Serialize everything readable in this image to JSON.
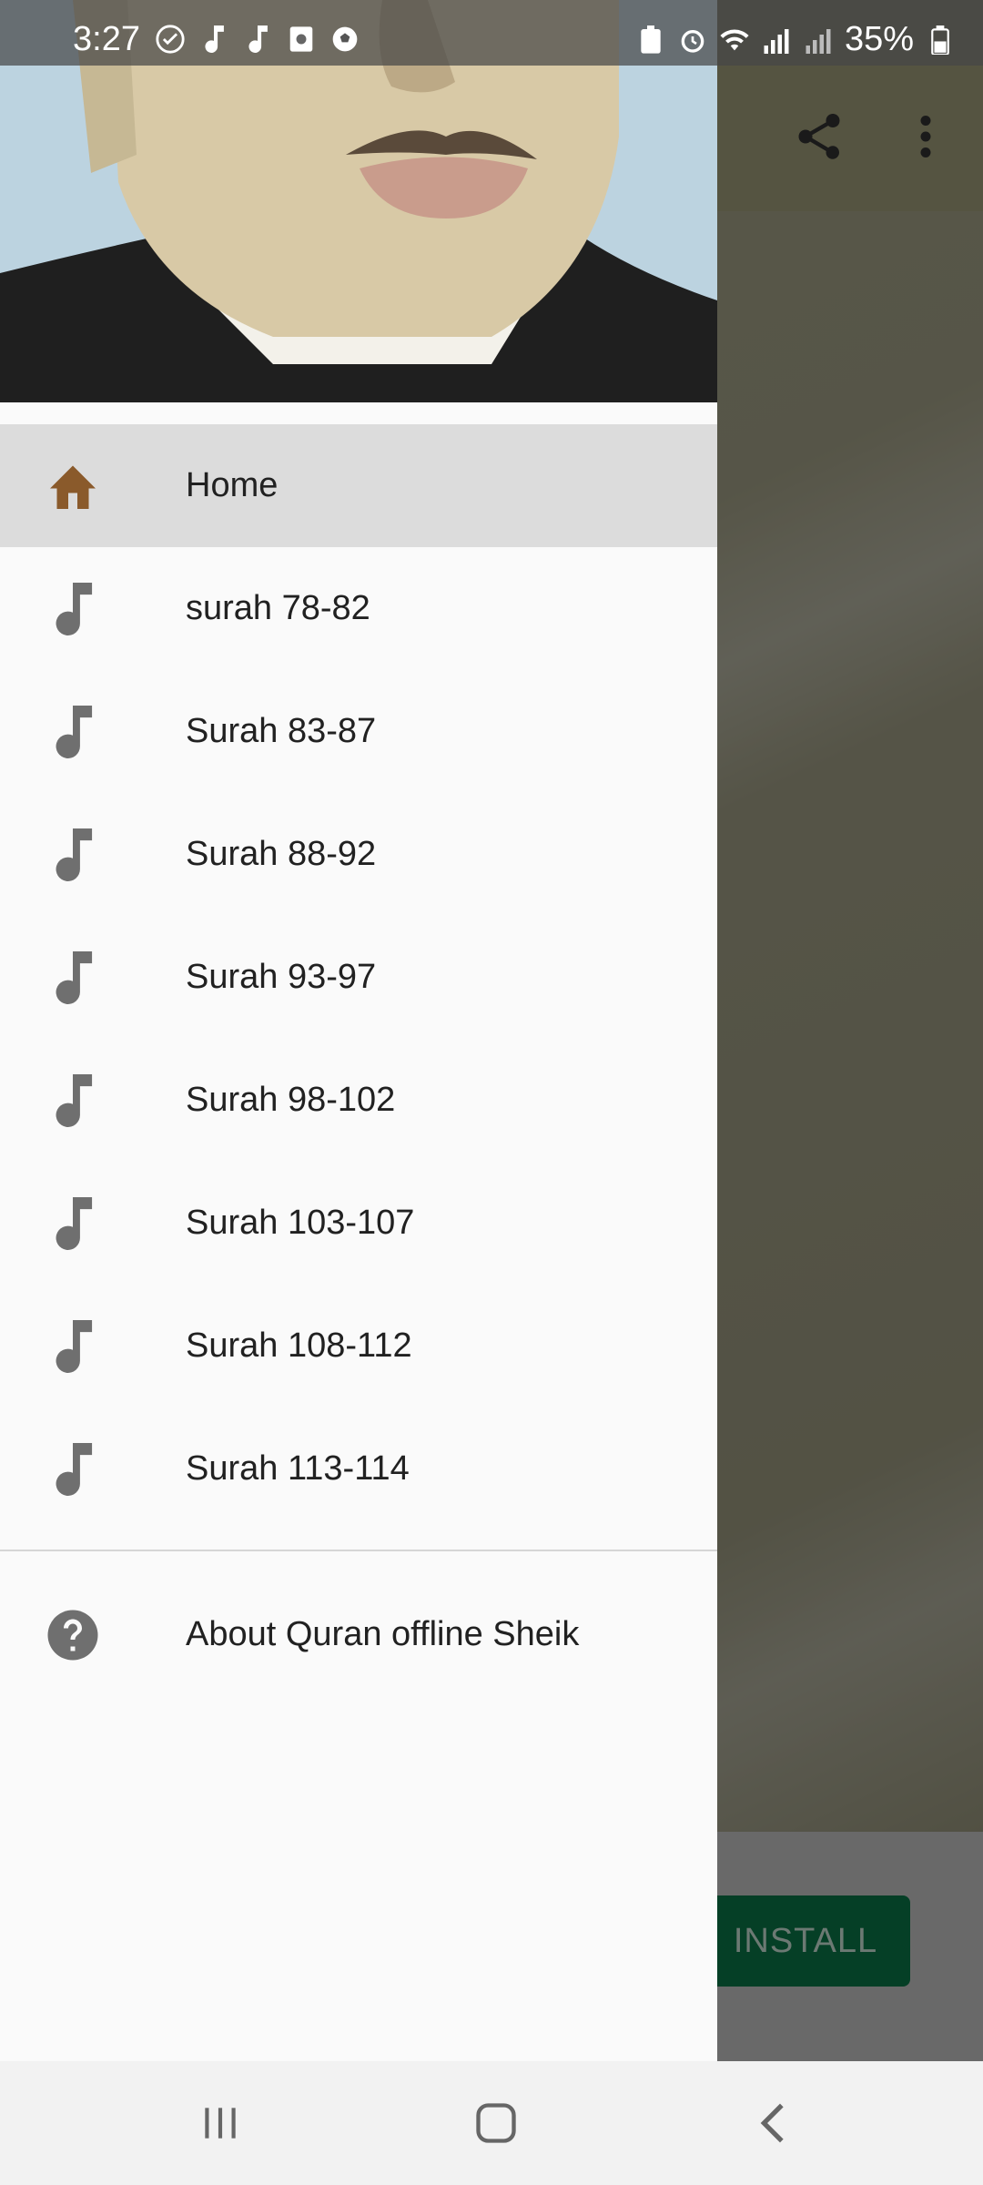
{
  "status_bar": {
    "time": "3:27",
    "battery": "35%",
    "left_icons": [
      "check-circle-icon",
      "music-note-icon",
      "music-note-icon",
      "sim-card-icon",
      "soccer-ball-icon"
    ],
    "right_icons": [
      "battery-saver-icon",
      "alarm-icon",
      "wifi-icon",
      "signal-icon",
      "signal-icon",
      "battery-icon"
    ]
  },
  "app": {
    "toolbar_icons": [
      "share-icon",
      "more-vert-icon"
    ],
    "install_label": "INSTALL"
  },
  "drawer": {
    "items": [
      {
        "label": "Home",
        "icon": "home-icon",
        "active": true
      },
      {
        "label": "surah 78-82",
        "icon": "music-note-icon"
      },
      {
        "label": "Surah 83-87",
        "icon": "music-note-icon"
      },
      {
        "label": "Surah 88-92",
        "icon": "music-note-icon"
      },
      {
        "label": "Surah 93-97",
        "icon": "music-note-icon"
      },
      {
        "label": "Surah 98-102",
        "icon": "music-note-icon"
      },
      {
        "label": "Surah 103-107",
        "icon": "music-note-icon"
      },
      {
        "label": "Surah 108-112",
        "icon": "music-note-icon"
      },
      {
        "label": "Surah 113-114",
        "icon": "music-note-icon"
      }
    ],
    "about_label": "About Quran offline Sheik"
  },
  "colors": {
    "accent_home": "#8a5a2b",
    "icon_gray": "#6f6f6f",
    "install_green": "#0b7a4a"
  }
}
